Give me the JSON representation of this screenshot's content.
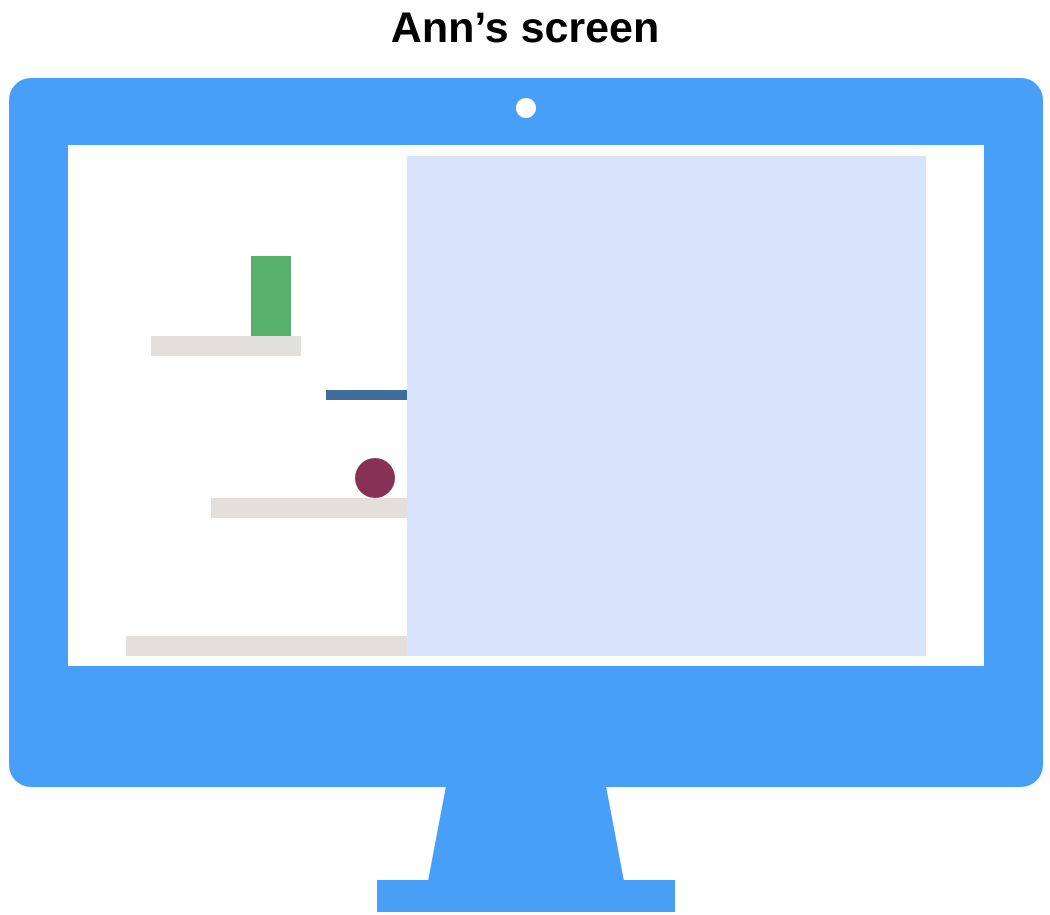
{
  "title": "Ann’s screen",
  "colors": {
    "monitor": "#479ff8",
    "screen_background": "#ffffff",
    "shelf": "#e2dfdc",
    "green_block": "#58b26b",
    "blue_stick": "#3e6d9c",
    "red_ball": "#873255",
    "occluder": "#d8e4fc"
  }
}
